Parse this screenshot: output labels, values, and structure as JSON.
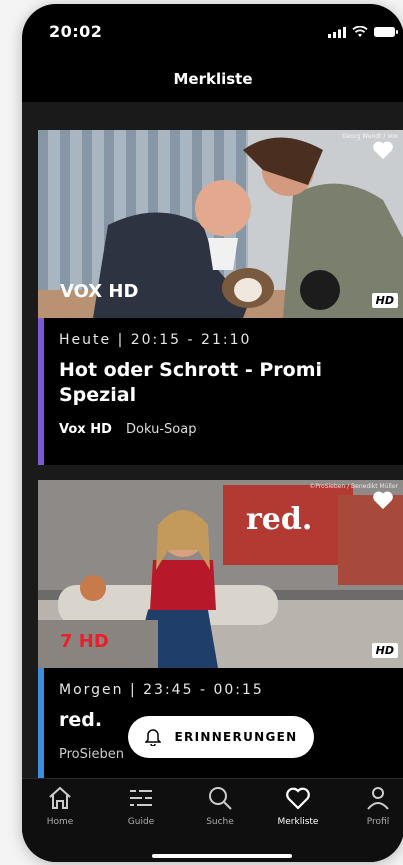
{
  "status": {
    "time": "20:02"
  },
  "header": {
    "title": "Merkliste"
  },
  "cards": [
    {
      "time_line": "Heute | 20:15 - 21:10",
      "title": "Hot oder Schrott - Promi Spezial",
      "channel": "Vox HD",
      "genre": "Doku-Soap",
      "logo": "VOX HD",
      "badge": "HD",
      "accent": "#7b5cd6",
      "credit": "Georg Wendt / Vox"
    },
    {
      "time_line": "Morgen | 23:45 - 00:15",
      "title": "red.",
      "channel": "ProSieben",
      "genre": "",
      "logo": "7 HD",
      "badge": "HD",
      "accent": "#3b8fe0",
      "credit": "©ProSieben / Benedikt Müller",
      "set_sign": "red."
    }
  ],
  "reminder": {
    "label": "ERINNERUNGEN"
  },
  "tabs": [
    {
      "label": "Home",
      "icon": "home-icon"
    },
    {
      "label": "Guide",
      "icon": "guide-icon"
    },
    {
      "label": "Suche",
      "icon": "search-icon"
    },
    {
      "label": "Merkliste",
      "icon": "heart-icon",
      "active": true
    },
    {
      "label": "Profil",
      "icon": "profile-icon"
    }
  ]
}
